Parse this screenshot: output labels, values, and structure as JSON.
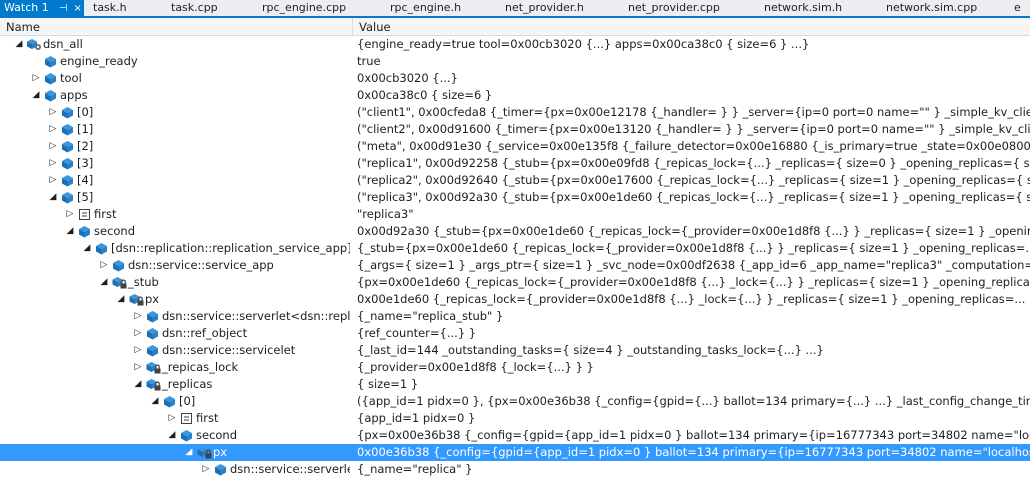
{
  "tabs": [
    {
      "label": "Watch 1",
      "active": true
    },
    {
      "label": "task.h"
    },
    {
      "label": "task.cpp"
    },
    {
      "label": "rpc_engine.cpp"
    },
    {
      "label": "rpc_engine.h"
    },
    {
      "label": "net_provider.h"
    },
    {
      "label": "net_provider.cpp"
    },
    {
      "label": "network.sim.h"
    },
    {
      "label": "network.sim.cpp"
    },
    {
      "label": "e"
    }
  ],
  "tab_pin_glyph": "⊣",
  "tab_close_glyph": "×",
  "columns": {
    "name": "Name",
    "value": "Value"
  },
  "rows": [
    {
      "toggle": "expanded",
      "icon": "struct-gear-icon",
      "name": "dsn_all",
      "value": "{engine_ready=true tool=0x00cb3020 {...} apps=0x00ca38c0 { size=6 } ...}"
    },
    {
      "toggle": "none",
      "icon": "field-icon",
      "name": "engine_ready",
      "value": "true"
    },
    {
      "toggle": "collapsed",
      "icon": "field-icon",
      "name": "tool",
      "value": "0x00cb3020 {...}"
    },
    {
      "toggle": "expanded",
      "icon": "field-icon",
      "name": "apps",
      "value": "0x00ca38c0 { size=6 }"
    },
    {
      "toggle": "collapsed",
      "icon": "field-icon",
      "name": "[0]",
      "value": "(\"client1\", 0x00cfeda8 {_timer={px=0x00e12178 {_handler= } } _server={ip=0 port=0 name=\"\" } _simple_kv_client=0x00e11530 {...} ...})"
    },
    {
      "toggle": "collapsed",
      "icon": "field-icon",
      "name": "[1]",
      "value": "(\"client2\", 0x00d91600 {_timer={px=0x00e13120 {_handler= } } _server={ip=0 port=0 name=\"\" } _simple_kv_client=0x00e124d8 {...} ...})"
    },
    {
      "toggle": "collapsed",
      "icon": "field-icon",
      "name": "[2]",
      "value": "(\"meta\", 0x00d91e30 {_service=0x00e135f8 {_failure_detector=0x00e16880 {_is_primary=true _state=0x00e08008 {...} ...} } })"
    },
    {
      "toggle": "collapsed",
      "icon": "field-icon",
      "name": "[3]",
      "value": "(\"replica1\", 0x00d92258 {_stub={px=0x00e09fd8 {_repicas_lock={...} _replicas={ size=0 } _opening_replicas={ size=0 } ...} } })"
    },
    {
      "toggle": "collapsed",
      "icon": "field-icon",
      "name": "[4]",
      "value": "(\"replica2\", 0x00d92640 {_stub={px=0x00e17600 {_repicas_lock={...} _replicas={ size=1 } _opening_replicas={ size=0 } ...} } })"
    },
    {
      "toggle": "expanded",
      "icon": "field-icon",
      "name": "[5]",
      "value": "(\"replica3\", 0x00d92a30 {_stub={px=0x00e1de60 {_repicas_lock={...} _replicas={ size=1 } _opening_replicas={ size=0 } ...} } })"
    },
    {
      "toggle": "collapsed",
      "icon": "box-icon",
      "name": "first",
      "value": "\"replica3\""
    },
    {
      "toggle": "expanded",
      "icon": "field-icon",
      "name": "second",
      "value": "0x00d92a30 {_stub={px=0x00e1de60 {_repicas_lock={_provider=0x00e1d8f8 {...} } _replicas={ size=1 } _opening_replicas=...} } }"
    },
    {
      "toggle": "expanded",
      "icon": "field-icon",
      "name": "[dsn::replication::replication_service_app]",
      "value": "{_stub={px=0x00e1de60 {_repicas_lock={_provider=0x00e1d8f8 {...} } _replicas={ size=1 } _opening_replicas=...} } }"
    },
    {
      "toggle": "collapsed",
      "icon": "field-icon",
      "name": "dsn::service::service_app",
      "value": "{_args={ size=1 } _args_ptr={ size=1 } _svc_node=0x00df2638 {_app_id=6 _app_name=\"replica3\" _computation=...} ...}"
    },
    {
      "toggle": "expanded",
      "icon": "locked-field-icon",
      "name": "_stub",
      "value": "{px=0x00e1de60 {_repicas_lock={_provider=0x00e1d8f8 {...} _lock={...} } _replicas={ size=1 } _opening_replicas=...} }"
    },
    {
      "toggle": "expanded",
      "icon": "locked-field-icon",
      "name": "px",
      "value": "0x00e1de60 {_repicas_lock={_provider=0x00e1d8f8 {...} _lock={...} } _replicas={ size=1 } _opening_replicas=..."
    },
    {
      "toggle": "collapsed",
      "icon": "field-icon",
      "name": "dsn::service::serverlet<dsn::replicati",
      "value": "{_name=\"replica_stub\" }"
    },
    {
      "toggle": "collapsed",
      "icon": "field-icon",
      "name": "dsn::ref_object",
      "value": "{ref_counter={...} }"
    },
    {
      "toggle": "collapsed",
      "icon": "field-icon",
      "name": "dsn::service::servicelet",
      "value": "{_last_id=144 _outstanding_tasks={ size=4 } _outstanding_tasks_lock={...} ...}"
    },
    {
      "toggle": "collapsed",
      "icon": "locked-field-icon",
      "name": "_repicas_lock",
      "value": "{_provider=0x00e1d8f8 {_lock={...} } }"
    },
    {
      "toggle": "expanded",
      "icon": "locked-field-icon",
      "name": "_replicas",
      "value": "{ size=1 }"
    },
    {
      "toggle": "expanded",
      "icon": "field-icon",
      "name": "[0]",
      "value": "({app_id=1 pidx=0 }, {px=0x00e36b38 {_config={gpid={...} ballot=134 primary={...} ...} _last_config_change_time_ms=241733 ...} })"
    },
    {
      "toggle": "collapsed",
      "icon": "box-icon",
      "name": "first",
      "value": "{app_id=1 pidx=0 }"
    },
    {
      "toggle": "expanded",
      "icon": "field-icon",
      "name": "second",
      "value": "{px=0x00e36b38 {_config={gpid={app_id=1 pidx=0 } ballot=134 primary={ip=16777343 port=34802 name=\"localhost\" } ...} ...} }"
    },
    {
      "toggle": "expanded",
      "icon": "locked-field-icon",
      "name": "px",
      "value": "0x00e36b38 {_config={gpid={app_id=1 pidx=0 } ballot=134 primary={ip=16777343 port=34802 name=\"localhost\" } ...} ...}",
      "selected": true
    },
    {
      "toggle": "collapsed",
      "icon": "field-icon",
      "name": "dsn::service::serverlet<",
      "value": "{_name=\"replica\" }"
    }
  ]
}
